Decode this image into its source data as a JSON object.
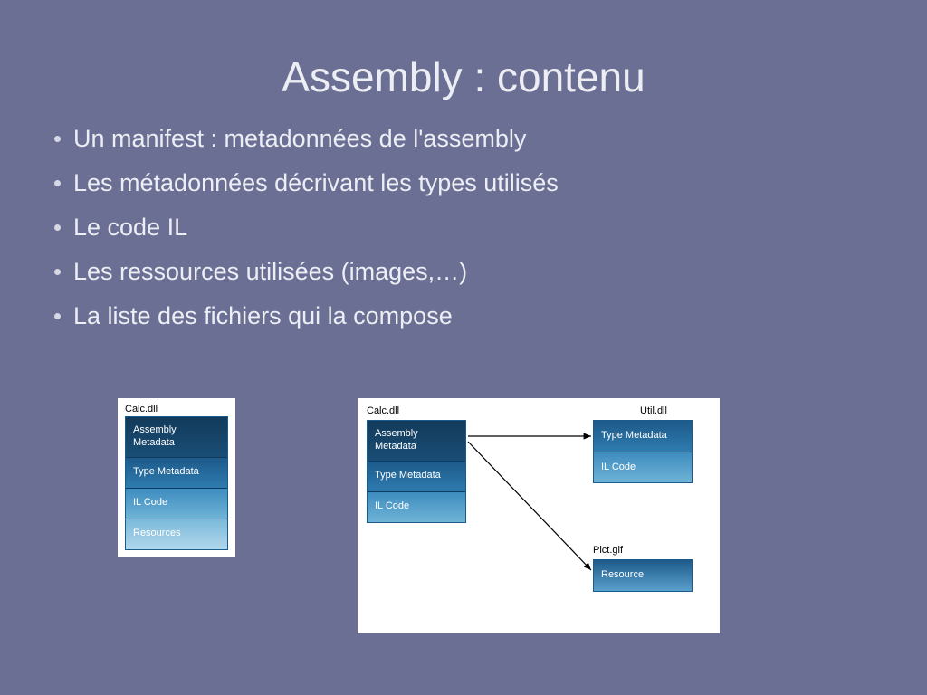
{
  "title": "Assembly : contenu",
  "bullets": [
    "Un manifest : metadonnées de l'assembly",
    "Les métadonnées décrivant les types utilisés",
    "Le code IL",
    "Les ressources utilisées (images,…)",
    "La liste des fichiers qui la compose"
  ],
  "diagram_left": {
    "file": "Calc.dll",
    "cells": [
      "Assembly Metadata",
      "Type Metadata",
      "IL Code",
      "Resources"
    ]
  },
  "diagram_right": {
    "calc": {
      "file": "Calc.dll",
      "cells": [
        "Assembly Metadata",
        "Type Metadata",
        "IL Code"
      ]
    },
    "util": {
      "file": "Util.dll",
      "cells": [
        "Type Metadata",
        "IL Code"
      ]
    },
    "pict": {
      "file": "Pict.gif",
      "cells": [
        "Resource"
      ]
    }
  }
}
